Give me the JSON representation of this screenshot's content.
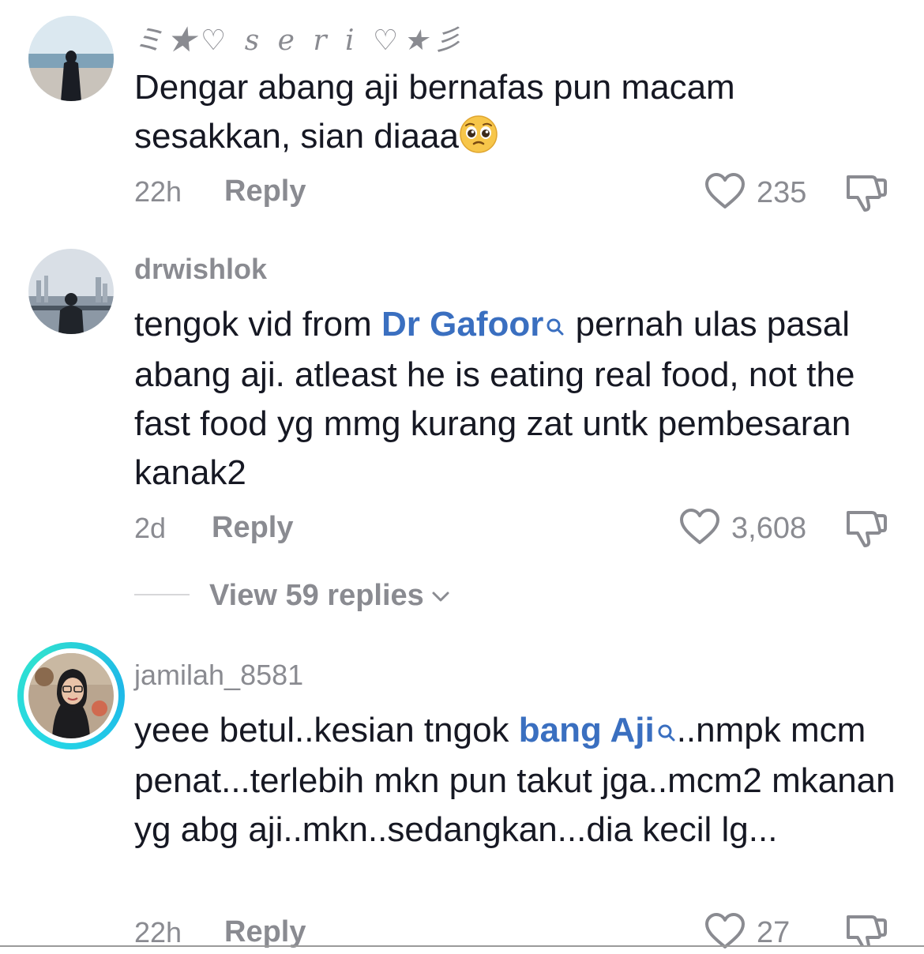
{
  "comments": [
    {
      "username": "ミ★♡ s e r i ♡★彡",
      "text": "Dengar abang aji bernafas pun macam sesakkan, sian diaaa",
      "emoji": "pleading-face-icon",
      "time": "22h",
      "reply": "Reply",
      "likes": "235"
    },
    {
      "username": "drwishlok",
      "text_before": "tengok vid from ",
      "mention": "Dr Gafoor",
      "text_after": " pernah ulas pasal abang aji. atleast he is eating real food, not the fast food yg mmg kurang zat untk pembesaran kanak2",
      "time": "2d",
      "reply": "Reply",
      "likes": "3,608",
      "view_replies": "View 59 replies"
    },
    {
      "username": "jamilah_8581",
      "text_before": "yeee betul..kesian tngok ",
      "mention": "bang Aji",
      "text_after": "..nmpk mcm penat...terlebih mkn pun takut jga..mcm2 mkanan yg abg aji..mkn..sedangkan...dia kecil lg...",
      "time": "22h",
      "reply": "Reply",
      "likes": "27"
    }
  ],
  "colors": {
    "mention": "#3a6fc0",
    "muted": "#8a8b91",
    "ring": "#25d6e6"
  }
}
